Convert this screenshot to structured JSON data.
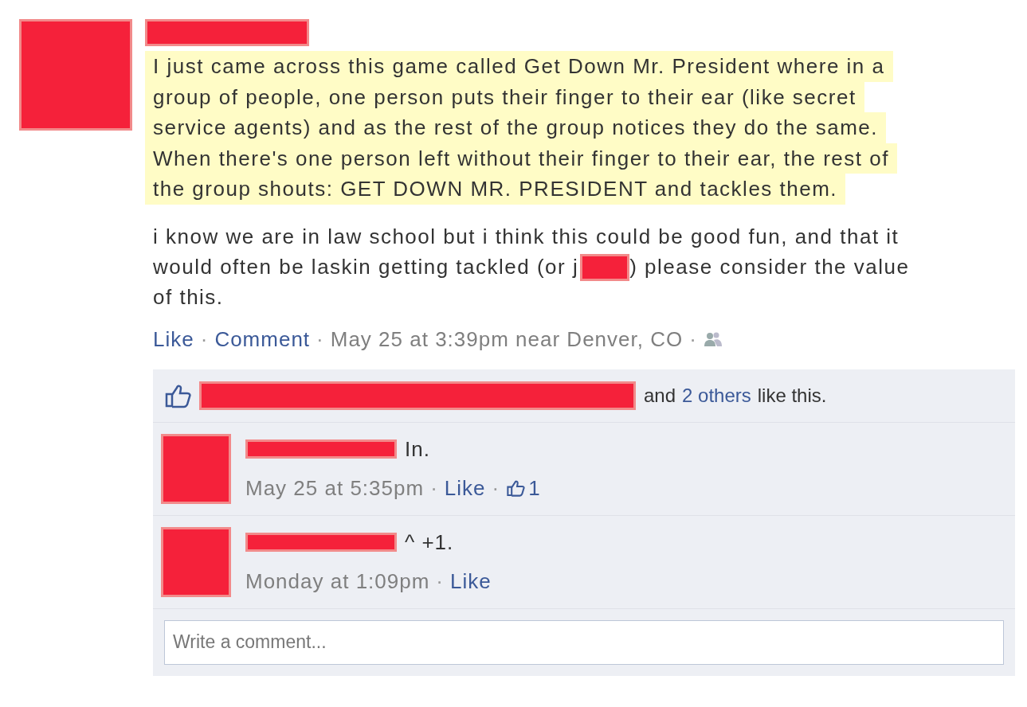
{
  "post": {
    "text_lines": [
      "I just came across this game called Get Down Mr. President where in a",
      "group of people, one person puts their finger to their ear (like secret",
      "service agents) and as the rest of the group notices they do the same.",
      "When there's one person left without their finger to their ear, the rest of",
      "the group shouts: GET DOWN MR. PRESIDENT and tackles them."
    ],
    "body_lines": [
      [
        "i know we are in law school but i think this could be good fun, and that it"
      ],
      [
        "would often be laskin getting tackled (or j",
        ") please consider the value"
      ],
      [
        "of this."
      ]
    ],
    "meta": [
      {
        "kind": "link",
        "text": "Like"
      },
      {
        "kind": "sep",
        "text": "·"
      },
      {
        "kind": "link",
        "text": "Comment"
      },
      {
        "kind": "sep",
        "text": "·"
      },
      {
        "kind": "info",
        "text": "May 25 at 3:39pm near Denver, CO"
      },
      {
        "kind": "sep",
        "text": "·"
      },
      {
        "kind": "audience"
      }
    ]
  },
  "likes": [
    {
      "kind": "info",
      "text": "and"
    },
    {
      "kind": "link",
      "text": "2 others"
    },
    {
      "kind": "info",
      "text": "like this."
    }
  ],
  "comments": [
    {
      "text": "In.",
      "meta": [
        {
          "kind": "info",
          "text": "May 25 at 5:35pm"
        },
        {
          "kind": "sep",
          "text": "·"
        },
        {
          "kind": "link",
          "text": "Like"
        },
        {
          "kind": "sep",
          "text": "·"
        },
        {
          "kind": "count",
          "text": "1"
        }
      ]
    },
    {
      "text": "^ +1.",
      "meta": [
        {
          "kind": "info",
          "text": "Monday at 1:09pm"
        },
        {
          "kind": "sep",
          "text": "·"
        },
        {
          "kind": "link",
          "text": "Like"
        }
      ]
    }
  ],
  "comment_box": {
    "placeholder": "Write a comment..."
  }
}
